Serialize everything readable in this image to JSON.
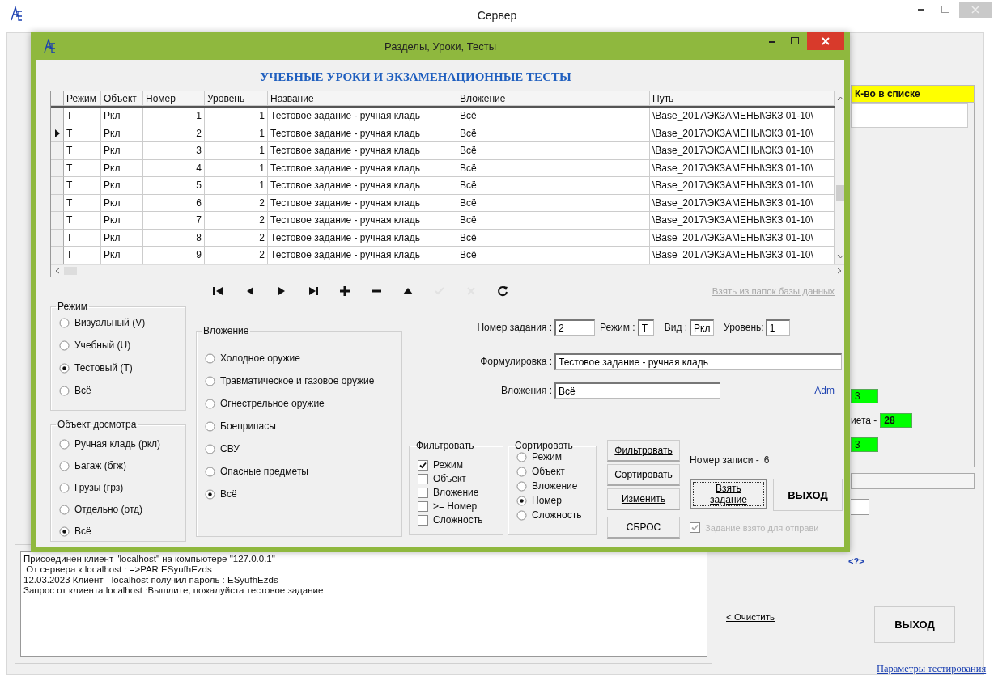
{
  "server_window": {
    "title": "Сервер",
    "count_label": "К-во в списке",
    "counters": [
      {
        "kind": "value",
        "text": "3"
      },
      {
        "kind": "labeled",
        "label": "иета -",
        "text": "28"
      },
      {
        "kind": "value",
        "text": "3"
      }
    ],
    "help_link": "<?>",
    "log_lines": [
      "Присоединен клиент \"localhost\" на компьютере \"127.0.0.1\"",
      " От сервера к localhost : =>PAR ESyufhEzds",
      "12.03.2023 Клиент - localhost получил пароль : ESyufhEzds",
      "Запрос от клиента localhost :Вышлите, пожалуйста тестовое задание"
    ],
    "clear_button": "< Очистить",
    "exit_button": "ВЫХОД",
    "settings_link": "Параметры тестирования"
  },
  "dialog": {
    "title": "Разделы, Уроки, Тесты",
    "heading": "УЧЕБНЫЕ УРОКИ И ЭКЗАМЕНАЦИОННЫЕ ТЕСТЫ",
    "grid": {
      "columns": [
        "Режим",
        "Объект",
        "Номер",
        "Уровень",
        "Название",
        "Вложение",
        "Путь"
      ],
      "rows": [
        {
          "selected": false,
          "cells": [
            "T",
            "Ркл",
            "1",
            "1",
            "Тестовое задание - ручная кладь",
            "Всё",
            "\\Base_2017\\ЭКЗАМЕНЫ\\ЭКЗ 01-10\\"
          ]
        },
        {
          "selected": true,
          "cells": [
            "T",
            "Ркл",
            "2",
            "1",
            "Тестовое задание - ручная кладь",
            "Всё",
            "\\Base_2017\\ЭКЗАМЕНЫ\\ЭКЗ 01-10\\"
          ]
        },
        {
          "selected": false,
          "cells": [
            "T",
            "Ркл",
            "3",
            "1",
            "Тестовое задание - ручная кладь",
            "Всё",
            "\\Base_2017\\ЭКЗАМЕНЫ\\ЭКЗ 01-10\\"
          ]
        },
        {
          "selected": false,
          "cells": [
            "T",
            "Ркл",
            "4",
            "1",
            "Тестовое задание - ручная кладь",
            "Всё",
            "\\Base_2017\\ЭКЗАМЕНЫ\\ЭКЗ 01-10\\"
          ]
        },
        {
          "selected": false,
          "cells": [
            "T",
            "Ркл",
            "5",
            "1",
            "Тестовое задание - ручная кладь",
            "Всё",
            "\\Base_2017\\ЭКЗАМЕНЫ\\ЭКЗ 01-10\\"
          ]
        },
        {
          "selected": false,
          "cells": [
            "T",
            "Ркл",
            "6",
            "2",
            "Тестовое задание - ручная кладь",
            "Всё",
            "\\Base_2017\\ЭКЗАМЕНЫ\\ЭКЗ 01-10\\"
          ]
        },
        {
          "selected": false,
          "cells": [
            "T",
            "Ркл",
            "7",
            "2",
            "Тестовое задание - ручная кладь",
            "Всё",
            "\\Base_2017\\ЭКЗАМЕНЫ\\ЭКЗ 01-10\\"
          ]
        },
        {
          "selected": false,
          "cells": [
            "T",
            "Ркл",
            "8",
            "2",
            "Тестовое задание - ручная кладь",
            "Всё",
            "\\Base_2017\\ЭКЗАМЕНЫ\\ЭКЗ 01-10\\"
          ]
        },
        {
          "selected": false,
          "cells": [
            "T",
            "Ркл",
            "9",
            "2",
            "Тестовое задание - ручная кладь",
            "Всё",
            "\\Base_2017\\ЭКЗАМЕНЫ\\ЭКЗ 01-10\\"
          ]
        }
      ]
    },
    "nav": [
      {
        "kind": "first",
        "disabled": false
      },
      {
        "kind": "prev",
        "disabled": false
      },
      {
        "kind": "next",
        "disabled": false
      },
      {
        "kind": "last",
        "disabled": false
      },
      {
        "kind": "add",
        "disabled": false
      },
      {
        "kind": "remove",
        "disabled": false
      },
      {
        "kind": "up",
        "disabled": false
      },
      {
        "kind": "post",
        "disabled": true
      },
      {
        "kind": "cancel",
        "disabled": true
      },
      {
        "kind": "refresh",
        "disabled": false
      }
    ],
    "db_link": {
      "label": "Взять из папок базы данных",
      "disabled": true
    },
    "mode_group": {
      "title": "Режим",
      "options": [
        {
          "label": "Визуальный (V)",
          "selected": false
        },
        {
          "label": "Учебный (U)",
          "selected": false
        },
        {
          "label": "Тестовый (T)",
          "selected": true
        },
        {
          "label": "Всё",
          "selected": false
        }
      ]
    },
    "object_group": {
      "title": "Объект досмотра",
      "options": [
        {
          "label": "Ручная кладь (ркл)",
          "selected": false
        },
        {
          "label": "Багаж (бгж)",
          "selected": false
        },
        {
          "label": "Грузы (грз)",
          "selected": false
        },
        {
          "label": "Отдельно (отд)",
          "selected": false
        },
        {
          "label": "Всё",
          "selected": true
        }
      ]
    },
    "attachment_group": {
      "title": "Вложение",
      "options": [
        {
          "label": "Холодное оружие",
          "selected": false
        },
        {
          "label": "Травматическое и газовое оружие",
          "selected": false
        },
        {
          "label": "Огнестрельное оружие",
          "selected": false
        },
        {
          "label": "Боеприпасы",
          "selected": false
        },
        {
          "label": "СВУ",
          "selected": false
        },
        {
          "label": "Опасные предметы",
          "selected": false
        },
        {
          "label": "Всё",
          "selected": true
        }
      ]
    },
    "fields": {
      "task_number": {
        "label": "Номер задания :",
        "value": "2"
      },
      "mode": {
        "label": "Режим :",
        "value": "T"
      },
      "kind": {
        "label": "Вид :",
        "value": "Ркл"
      },
      "level": {
        "label": "Уровень:",
        "value": "1"
      },
      "wording": {
        "label": "Формулировка :",
        "value": "Тестовое задание - ручная кладь"
      },
      "attachments": {
        "label": "Вложения :",
        "value": "Всё"
      }
    },
    "adm_link": "Adm",
    "filter_group": {
      "title": "Фильтровать",
      "items": [
        {
          "label": "Режим",
          "checked": true
        },
        {
          "label": "Объект",
          "checked": false
        },
        {
          "label": "Вложение",
          "checked": false
        },
        {
          "label": ">= Номер",
          "checked": false
        },
        {
          "label": "Сложность",
          "checked": false
        }
      ]
    },
    "sort_group": {
      "title": "Сортировать",
      "options": [
        {
          "label": "Режим",
          "selected": false
        },
        {
          "label": "Объект",
          "selected": false
        },
        {
          "label": "Вложение",
          "selected": false
        },
        {
          "label": "Номер",
          "selected": true
        },
        {
          "label": "Сложность",
          "selected": false
        }
      ]
    },
    "action_buttons": [
      "Фильтровать",
      "Сортировать",
      "Изменить",
      "СБРОС"
    ],
    "record_label": "Номер записи -",
    "record_value": "6",
    "take_button": "Взять задание",
    "exit_button": "ВЫХОД",
    "taken_checkbox": {
      "label": "Задание взято для отправи",
      "checked": true,
      "disabled": true
    }
  }
}
